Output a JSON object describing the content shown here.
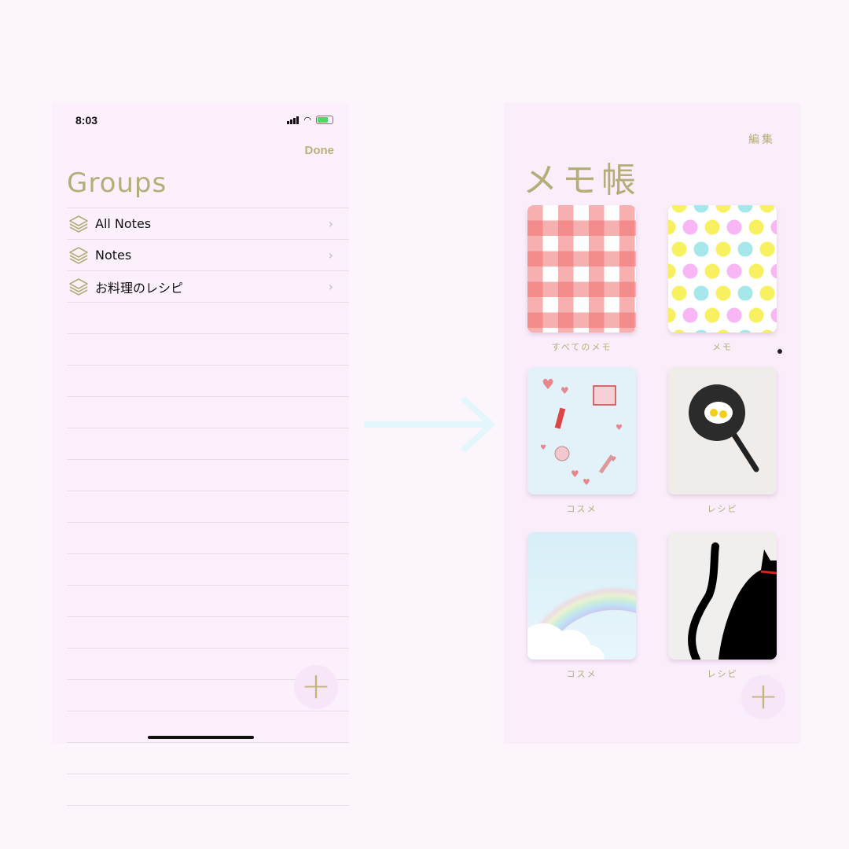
{
  "left": {
    "status": {
      "time": "8:03"
    },
    "done_label": "Done",
    "title": "Groups",
    "groups": [
      {
        "label": "All Notes"
      },
      {
        "label": "Notes"
      },
      {
        "label": "お料理のレシピ"
      }
    ],
    "add_label": "+"
  },
  "right": {
    "edit_label": "編集",
    "title": "メモ帳",
    "folders": [
      {
        "label": "すべてのメモ",
        "cover": "gingham"
      },
      {
        "label": "メモ",
        "cover": "polka-dots"
      },
      {
        "label": "コスメ",
        "cover": "cosmetics"
      },
      {
        "label": "レシピ",
        "cover": "frying-pan"
      },
      {
        "label": "コスメ",
        "cover": "rainbow"
      },
      {
        "label": "レシピ",
        "cover": "black-cat"
      }
    ],
    "add_label": "+"
  },
  "colors": {
    "accent": "#b5ad78",
    "background": "#fcf0fc",
    "arrow": "#e3f7fa"
  }
}
